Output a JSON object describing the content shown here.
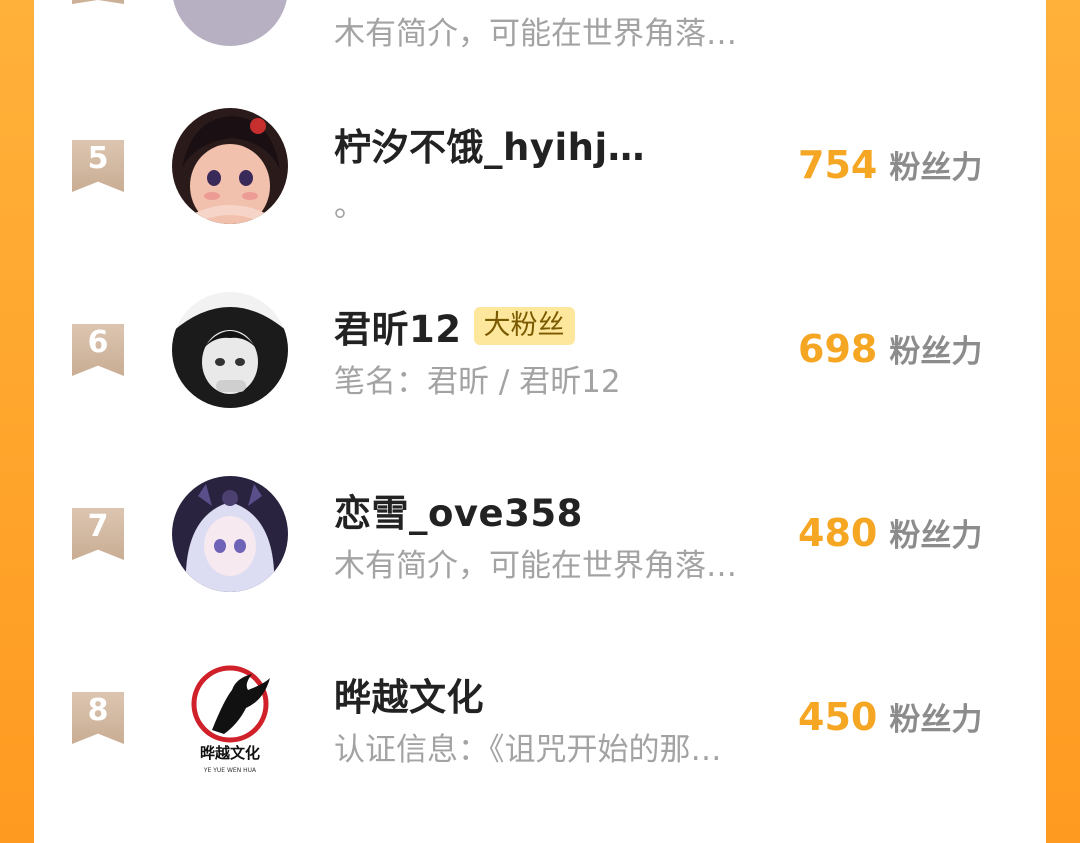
{
  "ranking": {
    "unit_label": "粉丝力",
    "rows": [
      {
        "rank": "",
        "name": "",
        "badge": "",
        "description": "木有简介，可能在世界角落…",
        "score": ""
      },
      {
        "rank": "5",
        "name": "柠汐不饿_hyihj…",
        "badge": "",
        "description": "。",
        "score": "754"
      },
      {
        "rank": "6",
        "name": "君昕12",
        "badge": "大粉丝",
        "description": "笔名：君昕 / 君昕12",
        "score": "698"
      },
      {
        "rank": "7",
        "name": "恋雪_ove358",
        "badge": "",
        "description": "木有简介，可能在世界角落…",
        "score": "480"
      },
      {
        "rank": "8",
        "name": "晔越文化",
        "badge": "",
        "description": "认证信息：《诅咒开始的那…",
        "score": "450",
        "logo_text": "晔越文化",
        "logo_subtext": "YE YUE WEN HUA"
      }
    ]
  },
  "colors": {
    "accent_orange": "#f5a623",
    "frame_orange": "#ff9a20",
    "rank_badge": "#d6bfa8",
    "fan_tag_bg": "#fde79c"
  },
  "icons": {
    "rank_badge": "ribbon-badge-icon"
  }
}
